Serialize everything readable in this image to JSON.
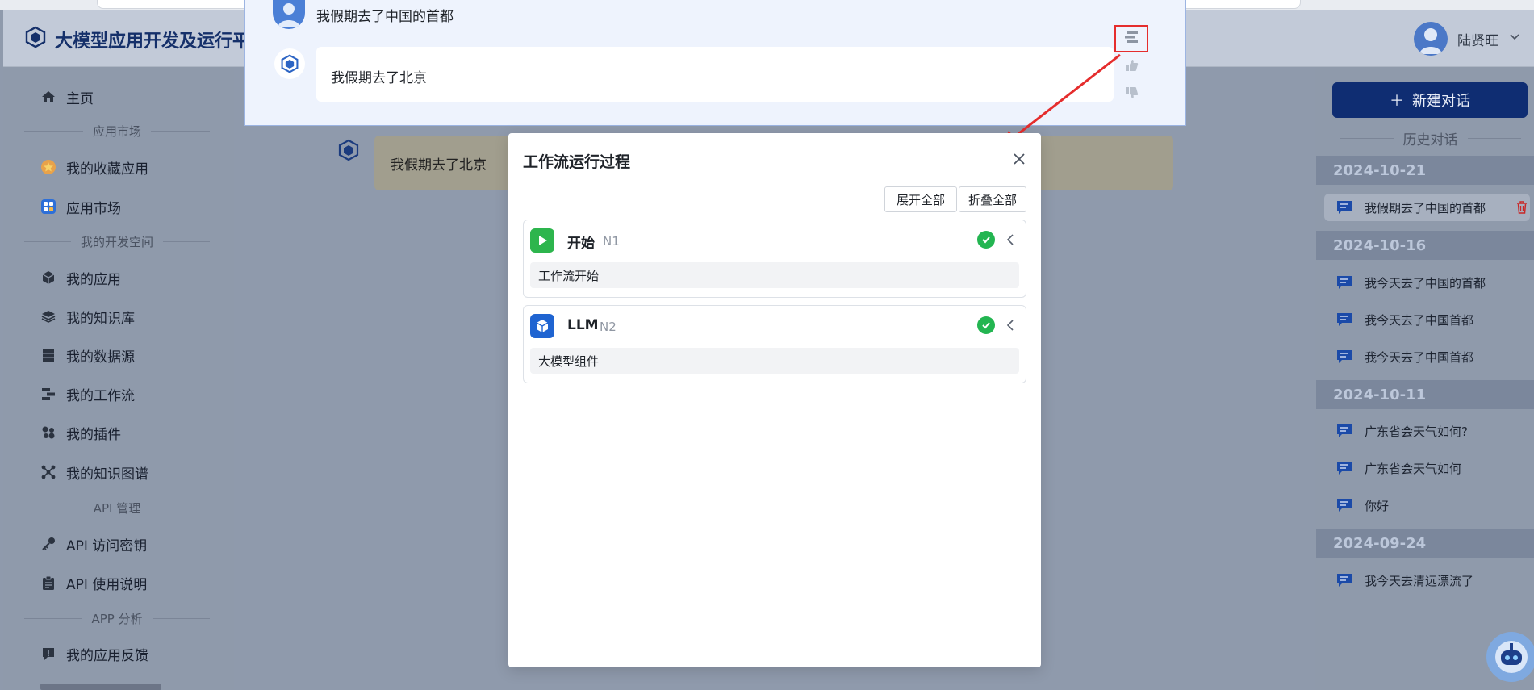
{
  "app": {
    "title": "大模型应用开发及运行平"
  },
  "user": {
    "name": "陆贤旺"
  },
  "sidebar": {
    "items": [
      {
        "label": "主页",
        "icon": "home-icon"
      },
      {
        "section": "应用市场"
      },
      {
        "label": "我的收藏应用",
        "icon": "star-icon"
      },
      {
        "label": "应用市场",
        "icon": "apps-icon"
      },
      {
        "section": "我的开发空间"
      },
      {
        "label": "我的应用",
        "icon": "cube-icon"
      },
      {
        "label": "我的知识库",
        "icon": "layers-icon"
      },
      {
        "label": "我的数据源",
        "icon": "database-icon"
      },
      {
        "label": "我的工作流",
        "icon": "workflow-icon"
      },
      {
        "label": "我的插件",
        "icon": "plugin-icon"
      },
      {
        "label": "我的知识图谱",
        "icon": "graph-icon"
      },
      {
        "section": "API 管理"
      },
      {
        "label": "API 访问密钥",
        "icon": "key-icon"
      },
      {
        "label": "API 使用说明",
        "icon": "clipboard-icon"
      },
      {
        "section": "APP 分析"
      },
      {
        "label": "我的应用反馈",
        "icon": "feedback-icon"
      }
    ]
  },
  "chat": {
    "user_question": "我假期去了中国的首都",
    "bot_answer": "我假期去了北京",
    "main_answer": "我假期去了北京"
  },
  "right_panel": {
    "new_chat_label": "新建对话",
    "history_title": "历史对话",
    "groups": [
      {
        "date": "2024-10-21",
        "items": [
          "我假期去了中国的首都"
        ]
      },
      {
        "date": "2024-10-16",
        "items": [
          "我今天去了中国的首都",
          "我今天去了中国首都",
          "我今天去了中国首都"
        ]
      },
      {
        "date": "2024-10-11",
        "items": [
          "广东省会天气如何?",
          "广东省会天气如何",
          "你好"
        ]
      },
      {
        "date": "2024-09-24",
        "items": [
          "我今天去清远漂流了"
        ]
      }
    ]
  },
  "modal": {
    "title": "工作流运行过程",
    "expand_all": "展开全部",
    "collapse_all": "折叠全部",
    "nodes": [
      {
        "name": "开始",
        "id": "N1",
        "desc": "工作流开始",
        "status": "success"
      },
      {
        "name": "LLM",
        "id": "N2",
        "desc": "大模型组件",
        "status": "success"
      }
    ]
  },
  "colors": {
    "brand": "#15306a",
    "primary_button": "#0f2d72",
    "success": "#23b551",
    "highlight": "#e52d2d"
  }
}
